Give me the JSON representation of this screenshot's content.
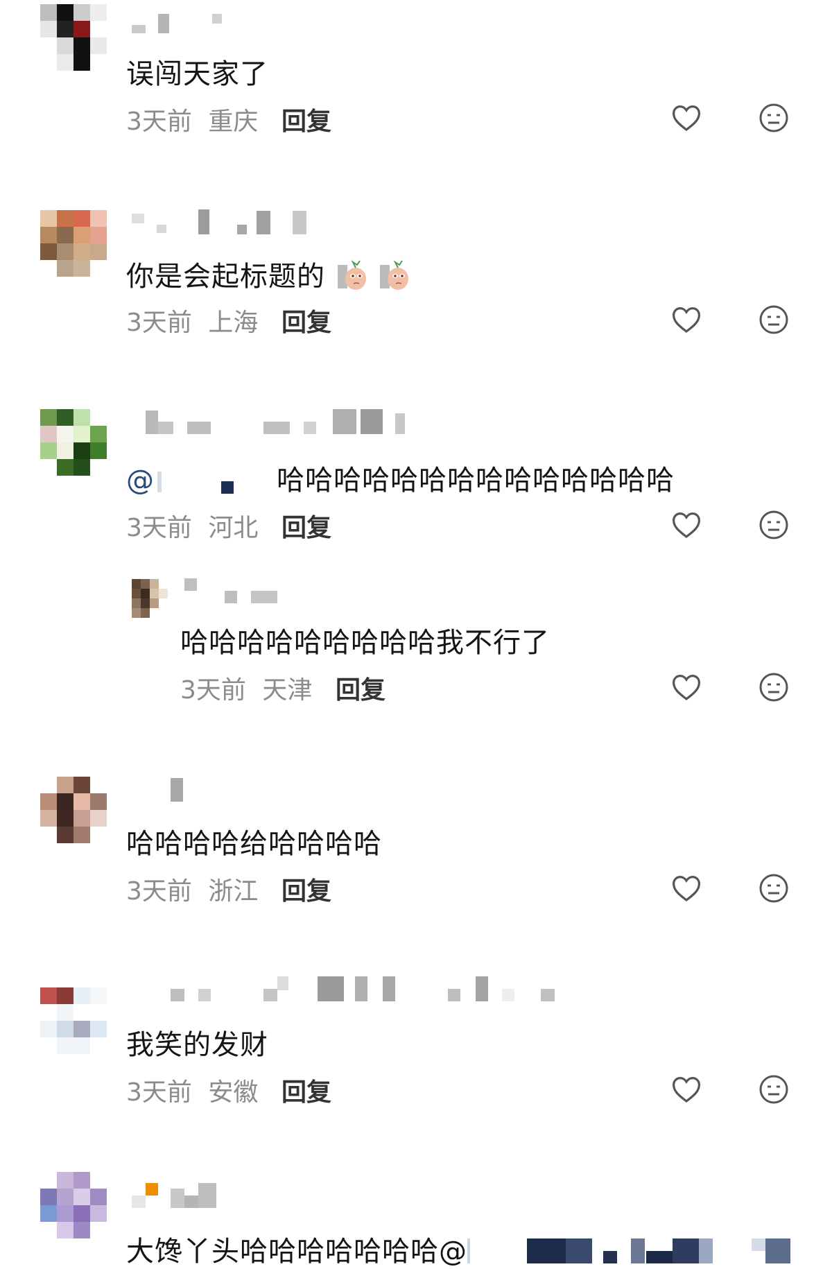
{
  "actions": {
    "reply_label": "回复"
  },
  "comments": [
    {
      "text": "误闯天家了",
      "time": "3天前",
      "location": "重庆"
    },
    {
      "text": "你是会起标题的",
      "time": "3天前",
      "location": "上海"
    },
    {
      "mention": "@",
      "text": "哈哈哈哈哈哈哈哈哈哈哈哈哈哈",
      "time": "3天前",
      "location": "河北"
    },
    {
      "text": "哈哈哈哈哈哈哈哈哈我不行了",
      "time": "3天前",
      "location": "天津"
    },
    {
      "text": "哈哈哈哈给哈哈哈哈",
      "time": "3天前",
      "location": "浙江"
    },
    {
      "text": "我笑的发财",
      "time": "3天前",
      "location": "安徽"
    },
    {
      "text": "大馋丫头哈哈哈哈哈哈哈@"
    }
  ],
  "icons": {
    "like": "heart-outline-icon",
    "dislike": "meh-face-icon",
    "emoji": "potato-sticker-icon"
  }
}
